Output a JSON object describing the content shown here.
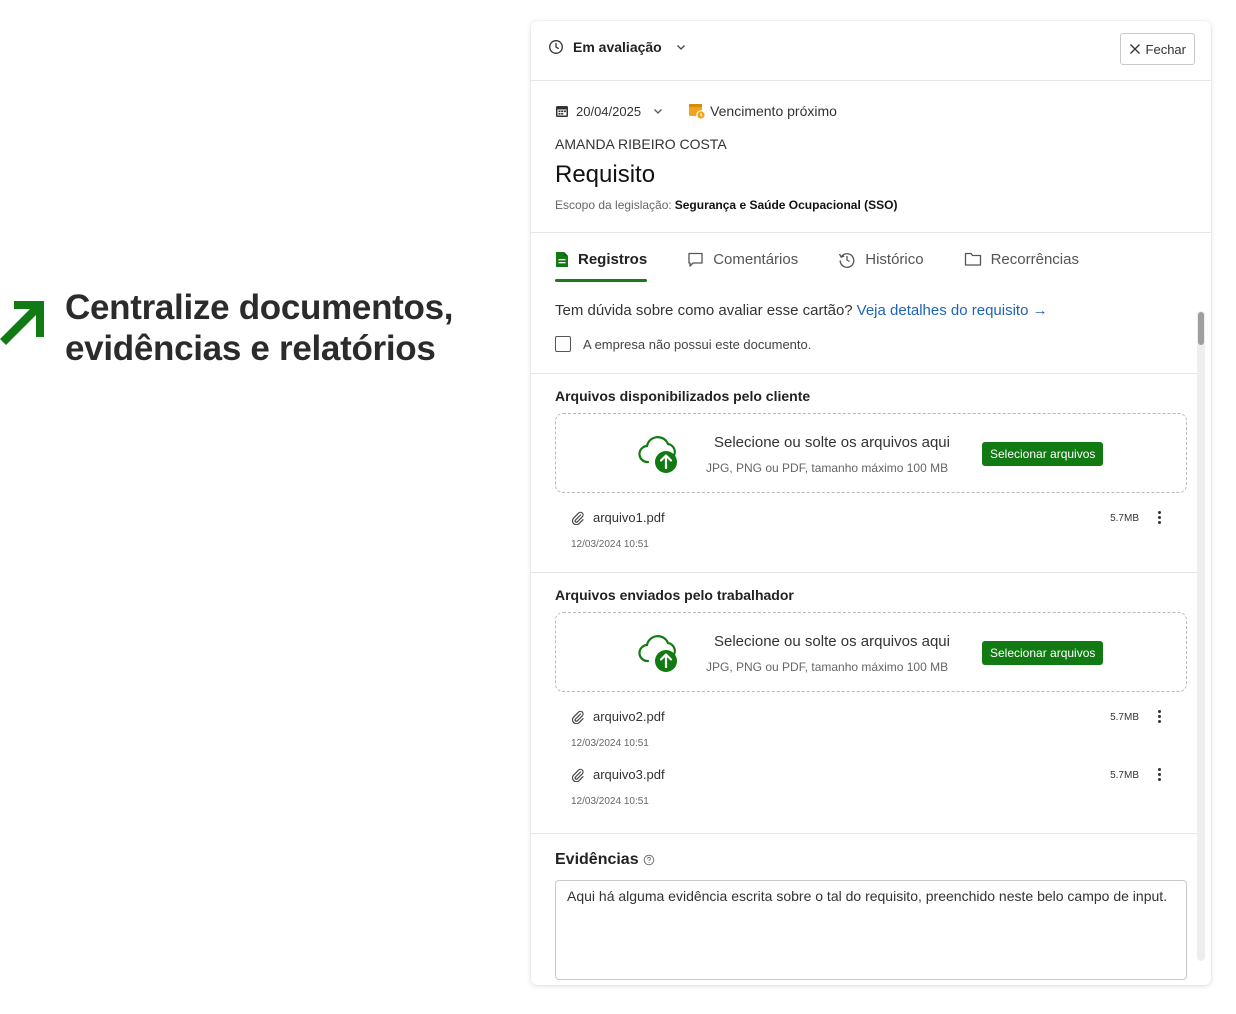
{
  "hero": {
    "line1": "Centralize documentos,",
    "line2": "evidências e relatórios"
  },
  "panel": {
    "status_label": "Em avaliação",
    "close_label": "Fechar",
    "date": "20/04/2025",
    "due_label": "Vencimento próximo",
    "person": "AMANDA RIBEIRO COSTA",
    "title": "Requisito",
    "scope_label": "Escopo da legislação:",
    "scope_value": "Segurança e Saúde Ocupacional (SSO)"
  },
  "tabs": [
    {
      "label": "Registros",
      "icon": "document-icon"
    },
    {
      "label": "Comentários",
      "icon": "comment-icon"
    },
    {
      "label": "Histórico",
      "icon": "history-icon"
    },
    {
      "label": "Recorrências",
      "icon": "folder-icon"
    }
  ],
  "help": {
    "question": "Tem dúvida sobre como avaliar esse cartão?",
    "link": "Veja detalhes do requisito →"
  },
  "no_document_label": "A empresa não possui este documento.",
  "sections": [
    {
      "title": "Arquivos disponibilizados pelo cliente",
      "dropzone_main": "Selecione ou solte os arquivos aqui",
      "dropzone_sub": "JPG, PNG ou PDF, tamanho máximo 100 MB",
      "button": "Selecionar arquivos",
      "files": [
        {
          "name": "arquivo1.pdf",
          "size": "5.7MB",
          "date": "12/03/2024 10:51"
        }
      ]
    },
    {
      "title": "Arquivos enviados pelo trabalhador",
      "dropzone_main": "Selecione ou solte os arquivos aqui",
      "dropzone_sub": "JPG, PNG ou PDF, tamanho máximo 100 MB",
      "button": "Selecionar arquivos",
      "files": [
        {
          "name": "arquivo2.pdf",
          "size": "5.7MB",
          "date": "12/03/2024 10:51"
        },
        {
          "name": "arquivo3.pdf",
          "size": "5.7MB",
          "date": "12/03/2024 10:51"
        }
      ]
    }
  ],
  "evidence": {
    "title": "Evidências",
    "text": "Aqui há alguma evidência escrita sobre o tal do requisito, preenchido neste belo campo de input."
  },
  "colors": {
    "brand_green": "#127a12",
    "link_blue": "#1f63b8",
    "warning_orange": "#f2a21b"
  }
}
